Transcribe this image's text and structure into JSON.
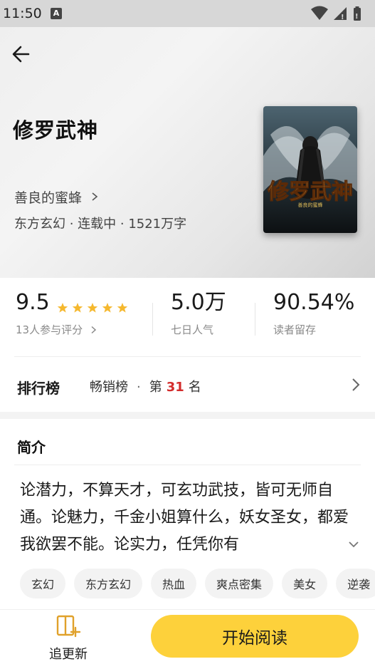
{
  "status_bar": {
    "time": "11:50",
    "badge": "A"
  },
  "colors": {
    "accent": "#fdd13b",
    "star": "#f5b82e",
    "rank_number": "#d32c2c"
  },
  "book": {
    "title": "修罗武神",
    "author": "善良的蜜蜂",
    "meta": "东方玄幻 · 连载中 · 1521万字",
    "cover_author_text": "善良的蜜蜂"
  },
  "stats": {
    "rating": {
      "value": "9.5",
      "label": "13人参与评分",
      "stars": 5
    },
    "popularity": {
      "value": "5.0万",
      "label": "七日人气"
    },
    "retention": {
      "value": "90.54%",
      "label": "读者留存"
    }
  },
  "ranking": {
    "title": "排行榜",
    "list": "畅销榜",
    "separator": "·",
    "prefix": "第",
    "rank": "31",
    "suffix": "名"
  },
  "intro": {
    "heading": "简介",
    "text": "论潜力，不算天才，可玄功武技，皆可无师自通。论魅力，千金小姐算什么，妖女圣女，都爱我欲罢不能。论实力，任凭你有"
  },
  "tags": [
    "玄幻",
    "东方玄幻",
    "热血",
    "爽点密集",
    "美女",
    "逆袭"
  ],
  "bottom": {
    "follow_label": "追更新",
    "read_label": "开始阅读"
  },
  "icons": [
    "back-arrow-icon",
    "chevron-right-icon",
    "star-icon",
    "chevron-down-icon",
    "bookshelf-add-icon",
    "wifi-icon",
    "signal-icon",
    "battery-icon"
  ]
}
